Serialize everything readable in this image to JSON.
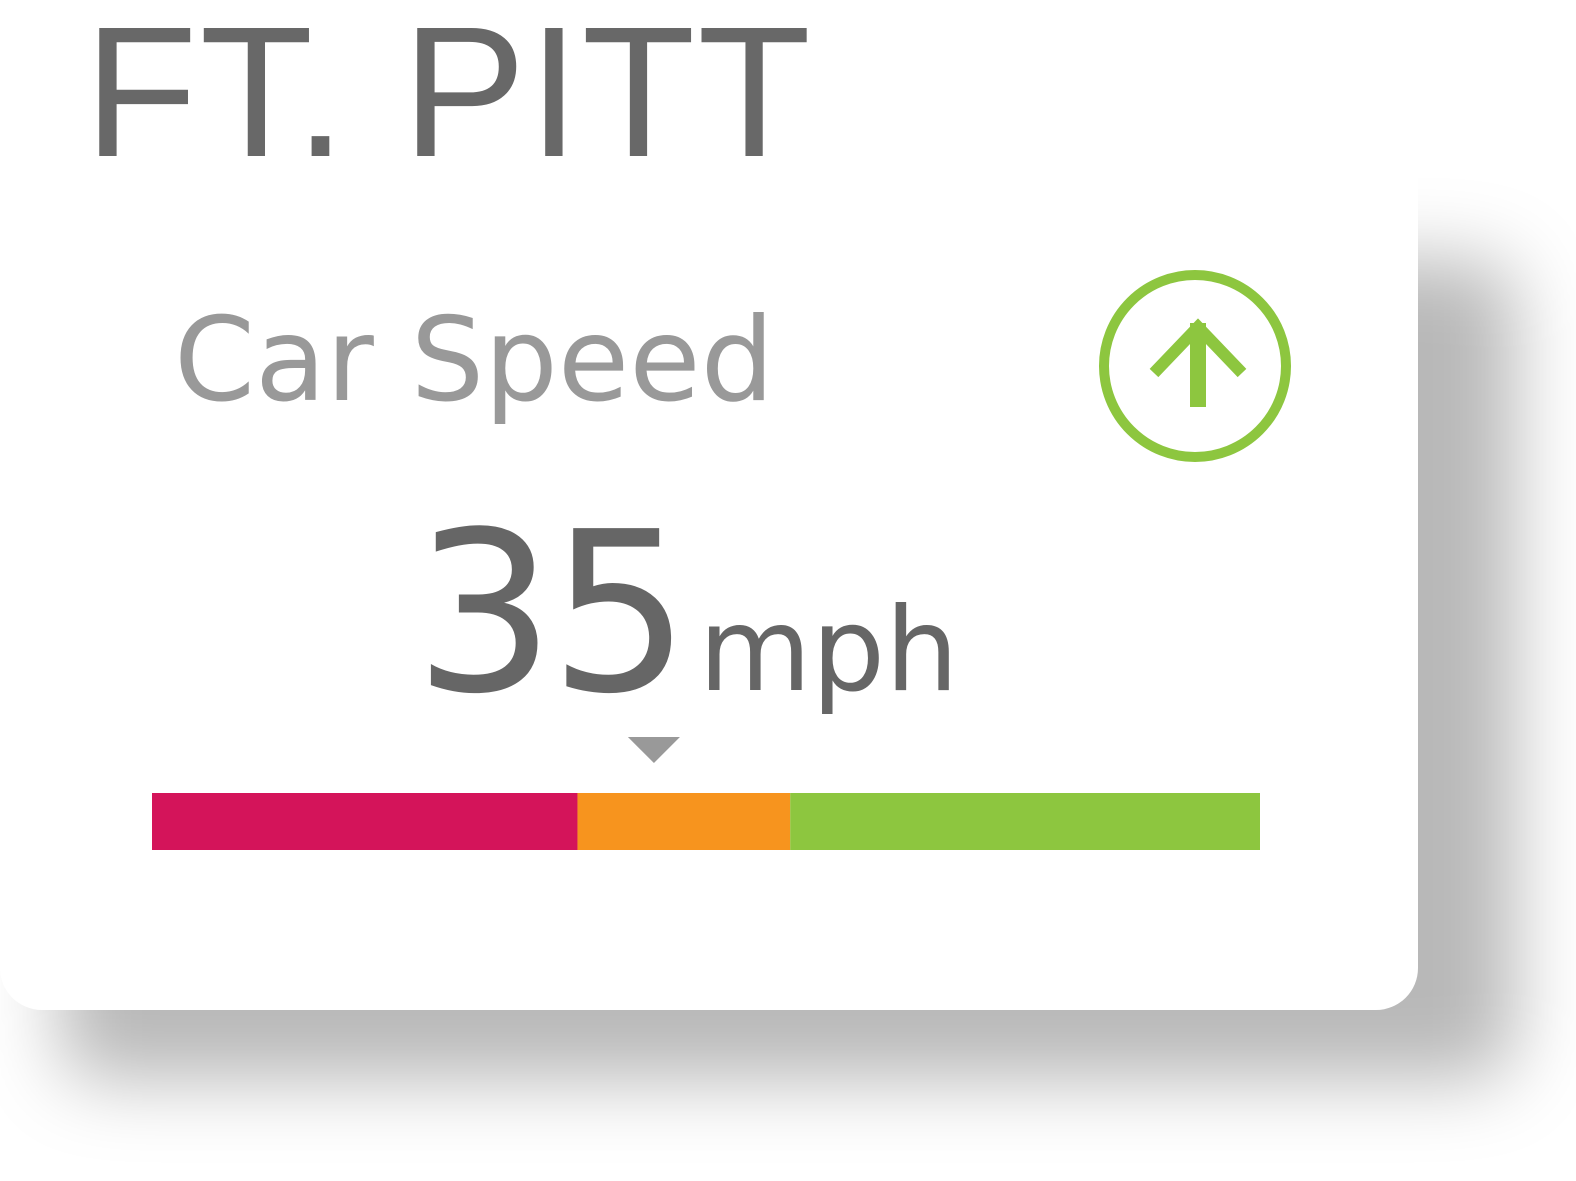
{
  "location": {
    "title": "FT. PITT"
  },
  "card": {
    "label": "Car Speed",
    "speed_value": "35",
    "speed_unit": "mph",
    "trend_icon": "arrow-up-circle-icon"
  },
  "gauge": {
    "segments": [
      {
        "name": "red",
        "fraction": 0.384,
        "color": "#D4145A"
      },
      {
        "name": "orange",
        "fraction": 0.192,
        "color": "#F7941E"
      },
      {
        "name": "green",
        "fraction": 0.424,
        "color": "#8DC63F"
      }
    ],
    "indicator_fraction": 0.453,
    "indicator_color": "#999999"
  },
  "colors": {
    "accent_green": "#8DC63F",
    "title_gray": "#686868",
    "label_gray": "#999999",
    "value_gray": "#666666"
  }
}
